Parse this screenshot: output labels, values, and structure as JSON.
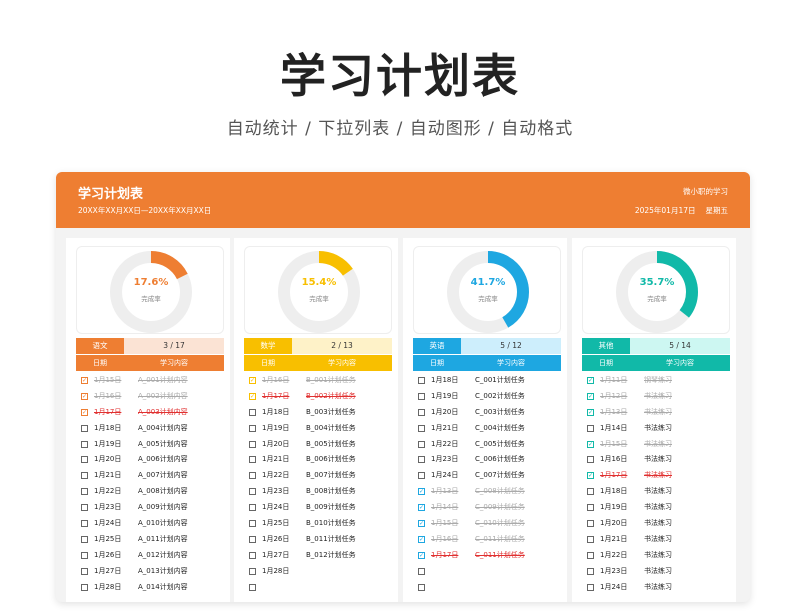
{
  "page": {
    "title": "学习计划表",
    "subtitle": "自动统计  /  下拉列表  /  自动图形  /  自动格式"
  },
  "sheet": {
    "title": "学习计划表",
    "range": "20XX年XX月XX日—20XX年XX月XX日",
    "author": "微小职的学习",
    "date": "2025年01月17日",
    "weekday": "星期五"
  },
  "columns": [
    {
      "subject": "语文",
      "count": "3 / 17",
      "percent_label": "17.6%",
      "percent": 0.176,
      "rate_label": "完成率",
      "color": "#ee7e32",
      "light": "#fbe3d4",
      "header": {
        "date": "日期",
        "content": "学习内容"
      },
      "rows": [
        {
          "date": "1月15日",
          "content": "A_001计划内容",
          "status": "done"
        },
        {
          "date": "1月16日",
          "content": "A_002计划内容",
          "status": "done"
        },
        {
          "date": "1月17日",
          "content": "A_003计划内容",
          "status": "current"
        },
        {
          "date": "1月18日",
          "content": "A_004计划内容",
          "status": "open"
        },
        {
          "date": "1月19日",
          "content": "A_005计划内容",
          "status": "open"
        },
        {
          "date": "1月20日",
          "content": "A_006计划内容",
          "status": "open"
        },
        {
          "date": "1月21日",
          "content": "A_007计划内容",
          "status": "open"
        },
        {
          "date": "1月22日",
          "content": "A_008计划内容",
          "status": "open"
        },
        {
          "date": "1月23日",
          "content": "A_009计划内容",
          "status": "open"
        },
        {
          "date": "1月24日",
          "content": "A_010计划内容",
          "status": "open"
        },
        {
          "date": "1月25日",
          "content": "A_011计划内容",
          "status": "open"
        },
        {
          "date": "1月26日",
          "content": "A_012计划内容",
          "status": "open"
        },
        {
          "date": "1月27日",
          "content": "A_013计划内容",
          "status": "open"
        },
        {
          "date": "1月28日",
          "content": "A_014计划内容",
          "status": "open"
        }
      ]
    },
    {
      "subject": "数学",
      "count": "2 / 13",
      "percent_label": "15.4%",
      "percent": 0.154,
      "rate_label": "完成率",
      "color": "#f8bf00",
      "light": "#fef2c8",
      "header": {
        "date": "日期",
        "content": "学习内容"
      },
      "rows": [
        {
          "date": "1月16日",
          "content": "B_001计划任务",
          "status": "done"
        },
        {
          "date": "1月17日",
          "content": "B_002计划任务",
          "status": "current"
        },
        {
          "date": "1月18日",
          "content": "B_003计划任务",
          "status": "open"
        },
        {
          "date": "1月19日",
          "content": "B_004计划任务",
          "status": "open"
        },
        {
          "date": "1月20日",
          "content": "B_005计划任务",
          "status": "open"
        },
        {
          "date": "1月21日",
          "content": "B_006计划任务",
          "status": "open"
        },
        {
          "date": "1月22日",
          "content": "B_007计划任务",
          "status": "open"
        },
        {
          "date": "1月23日",
          "content": "B_008计划任务",
          "status": "open"
        },
        {
          "date": "1月24日",
          "content": "B_009计划任务",
          "status": "open"
        },
        {
          "date": "1月25日",
          "content": "B_010计划任务",
          "status": "open"
        },
        {
          "date": "1月26日",
          "content": "B_011计划任务",
          "status": "open"
        },
        {
          "date": "1月27日",
          "content": "B_012计划任务",
          "status": "open"
        },
        {
          "date": "1月28日",
          "content": "",
          "status": "open"
        },
        {
          "date": "",
          "content": "",
          "status": "open"
        }
      ]
    },
    {
      "subject": "英语",
      "count": "5 / 12",
      "percent_label": "41.7%",
      "percent": 0.417,
      "rate_label": "完成率",
      "color": "#1ea7e1",
      "light": "#cdeefc",
      "header": {
        "date": "日期",
        "content": "学习内容"
      },
      "rows": [
        {
          "date": "1月18日",
          "content": "C_001计划任务",
          "status": "open"
        },
        {
          "date": "1月19日",
          "content": "C_002计划任务",
          "status": "open"
        },
        {
          "date": "1月20日",
          "content": "C_003计划任务",
          "status": "open"
        },
        {
          "date": "1月21日",
          "content": "C_004计划任务",
          "status": "open"
        },
        {
          "date": "1月22日",
          "content": "C_005计划任务",
          "status": "open"
        },
        {
          "date": "1月23日",
          "content": "C_006计划任务",
          "status": "open"
        },
        {
          "date": "1月24日",
          "content": "C_007计划任务",
          "status": "open"
        },
        {
          "date": "1月13日",
          "content": "C_008计划任务",
          "status": "done"
        },
        {
          "date": "1月14日",
          "content": "C_009计划任务",
          "status": "done"
        },
        {
          "date": "1月15日",
          "content": "C_010计划任务",
          "status": "done"
        },
        {
          "date": "1月16日",
          "content": "C_011计划任务",
          "status": "done"
        },
        {
          "date": "1月17日",
          "content": "C_011计划任务",
          "status": "current"
        },
        {
          "date": "",
          "content": "",
          "status": "open"
        },
        {
          "date": "",
          "content": "",
          "status": "open"
        }
      ]
    },
    {
      "subject": "其他",
      "count": "5 / 14",
      "percent_label": "35.7%",
      "percent": 0.357,
      "rate_label": "完成率",
      "color": "#11b9a8",
      "light": "#cdf7f2",
      "header": {
        "date": "日期",
        "content": "学习内容"
      },
      "rows": [
        {
          "date": "1月11日",
          "content": "钢琴练习",
          "status": "done"
        },
        {
          "date": "1月12日",
          "content": "书法练习",
          "status": "done"
        },
        {
          "date": "1月13日",
          "content": "书法练习",
          "status": "done"
        },
        {
          "date": "1月14日",
          "content": "书法练习",
          "status": "open"
        },
        {
          "date": "1月15日",
          "content": "书法练习",
          "status": "done"
        },
        {
          "date": "1月16日",
          "content": "书法练习",
          "status": "open"
        },
        {
          "date": "1月17日",
          "content": "书法练习",
          "status": "current"
        },
        {
          "date": "1月18日",
          "content": "书法练习",
          "status": "open"
        },
        {
          "date": "1月19日",
          "content": "书法练习",
          "status": "open"
        },
        {
          "date": "1月20日",
          "content": "书法练习",
          "status": "open"
        },
        {
          "date": "1月21日",
          "content": "书法练习",
          "status": "open"
        },
        {
          "date": "1月22日",
          "content": "书法练习",
          "status": "open"
        },
        {
          "date": "1月23日",
          "content": "书法练习",
          "status": "open"
        },
        {
          "date": "1月24日",
          "content": "书法练习",
          "status": "open"
        }
      ]
    }
  ]
}
